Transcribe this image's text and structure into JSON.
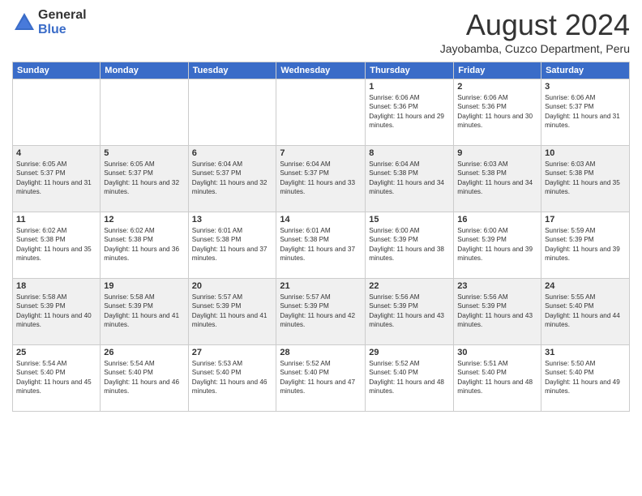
{
  "header": {
    "logo_general": "General",
    "logo_blue": "Blue",
    "month_year": "August 2024",
    "location": "Jayobamba, Cuzco Department, Peru"
  },
  "weekdays": [
    "Sunday",
    "Monday",
    "Tuesday",
    "Wednesday",
    "Thursday",
    "Friday",
    "Saturday"
  ],
  "weeks": [
    [
      {
        "day": "",
        "info": ""
      },
      {
        "day": "",
        "info": ""
      },
      {
        "day": "",
        "info": ""
      },
      {
        "day": "",
        "info": ""
      },
      {
        "day": "1",
        "info": "Sunrise: 6:06 AM\nSunset: 5:36 PM\nDaylight: 11 hours and 29 minutes."
      },
      {
        "day": "2",
        "info": "Sunrise: 6:06 AM\nSunset: 5:36 PM\nDaylight: 11 hours and 30 minutes."
      },
      {
        "day": "3",
        "info": "Sunrise: 6:06 AM\nSunset: 5:37 PM\nDaylight: 11 hours and 31 minutes."
      }
    ],
    [
      {
        "day": "4",
        "info": "Sunrise: 6:05 AM\nSunset: 5:37 PM\nDaylight: 11 hours and 31 minutes."
      },
      {
        "day": "5",
        "info": "Sunrise: 6:05 AM\nSunset: 5:37 PM\nDaylight: 11 hours and 32 minutes."
      },
      {
        "day": "6",
        "info": "Sunrise: 6:04 AM\nSunset: 5:37 PM\nDaylight: 11 hours and 32 minutes."
      },
      {
        "day": "7",
        "info": "Sunrise: 6:04 AM\nSunset: 5:37 PM\nDaylight: 11 hours and 33 minutes."
      },
      {
        "day": "8",
        "info": "Sunrise: 6:04 AM\nSunset: 5:38 PM\nDaylight: 11 hours and 34 minutes."
      },
      {
        "day": "9",
        "info": "Sunrise: 6:03 AM\nSunset: 5:38 PM\nDaylight: 11 hours and 34 minutes."
      },
      {
        "day": "10",
        "info": "Sunrise: 6:03 AM\nSunset: 5:38 PM\nDaylight: 11 hours and 35 minutes."
      }
    ],
    [
      {
        "day": "11",
        "info": "Sunrise: 6:02 AM\nSunset: 5:38 PM\nDaylight: 11 hours and 35 minutes."
      },
      {
        "day": "12",
        "info": "Sunrise: 6:02 AM\nSunset: 5:38 PM\nDaylight: 11 hours and 36 minutes."
      },
      {
        "day": "13",
        "info": "Sunrise: 6:01 AM\nSunset: 5:38 PM\nDaylight: 11 hours and 37 minutes."
      },
      {
        "day": "14",
        "info": "Sunrise: 6:01 AM\nSunset: 5:38 PM\nDaylight: 11 hours and 37 minutes."
      },
      {
        "day": "15",
        "info": "Sunrise: 6:00 AM\nSunset: 5:39 PM\nDaylight: 11 hours and 38 minutes."
      },
      {
        "day": "16",
        "info": "Sunrise: 6:00 AM\nSunset: 5:39 PM\nDaylight: 11 hours and 39 minutes."
      },
      {
        "day": "17",
        "info": "Sunrise: 5:59 AM\nSunset: 5:39 PM\nDaylight: 11 hours and 39 minutes."
      }
    ],
    [
      {
        "day": "18",
        "info": "Sunrise: 5:58 AM\nSunset: 5:39 PM\nDaylight: 11 hours and 40 minutes."
      },
      {
        "day": "19",
        "info": "Sunrise: 5:58 AM\nSunset: 5:39 PM\nDaylight: 11 hours and 41 minutes."
      },
      {
        "day": "20",
        "info": "Sunrise: 5:57 AM\nSunset: 5:39 PM\nDaylight: 11 hours and 41 minutes."
      },
      {
        "day": "21",
        "info": "Sunrise: 5:57 AM\nSunset: 5:39 PM\nDaylight: 11 hours and 42 minutes."
      },
      {
        "day": "22",
        "info": "Sunrise: 5:56 AM\nSunset: 5:39 PM\nDaylight: 11 hours and 43 minutes."
      },
      {
        "day": "23",
        "info": "Sunrise: 5:56 AM\nSunset: 5:39 PM\nDaylight: 11 hours and 43 minutes."
      },
      {
        "day": "24",
        "info": "Sunrise: 5:55 AM\nSunset: 5:40 PM\nDaylight: 11 hours and 44 minutes."
      }
    ],
    [
      {
        "day": "25",
        "info": "Sunrise: 5:54 AM\nSunset: 5:40 PM\nDaylight: 11 hours and 45 minutes."
      },
      {
        "day": "26",
        "info": "Sunrise: 5:54 AM\nSunset: 5:40 PM\nDaylight: 11 hours and 46 minutes."
      },
      {
        "day": "27",
        "info": "Sunrise: 5:53 AM\nSunset: 5:40 PM\nDaylight: 11 hours and 46 minutes."
      },
      {
        "day": "28",
        "info": "Sunrise: 5:52 AM\nSunset: 5:40 PM\nDaylight: 11 hours and 47 minutes."
      },
      {
        "day": "29",
        "info": "Sunrise: 5:52 AM\nSunset: 5:40 PM\nDaylight: 11 hours and 48 minutes."
      },
      {
        "day": "30",
        "info": "Sunrise: 5:51 AM\nSunset: 5:40 PM\nDaylight: 11 hours and 48 minutes."
      },
      {
        "day": "31",
        "info": "Sunrise: 5:50 AM\nSunset: 5:40 PM\nDaylight: 11 hours and 49 minutes."
      }
    ]
  ]
}
